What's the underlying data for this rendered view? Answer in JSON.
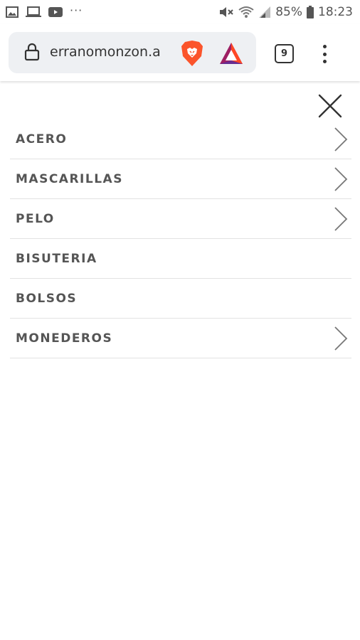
{
  "status_bar": {
    "battery": "85%",
    "time": "18:23",
    "notification_icons": [
      "image-icon",
      "laptop-icon",
      "youtube-icon"
    ],
    "system_icons": [
      "mute-icon",
      "wifi-icon",
      "signal-icon",
      "battery-icon"
    ],
    "more": "···"
  },
  "browser": {
    "url": "erranomonzon.a",
    "tab_count": "9"
  },
  "menu": {
    "items": [
      {
        "label": "ACERO",
        "has_submenu": true
      },
      {
        "label": "MASCARILLAS",
        "has_submenu": true
      },
      {
        "label": "PELO",
        "has_submenu": true
      },
      {
        "label": "BISUTERIA",
        "has_submenu": false
      },
      {
        "label": "BOLSOS",
        "has_submenu": false
      },
      {
        "label": "MONEDEROS",
        "has_submenu": true
      }
    ]
  },
  "colors": {
    "brave_orange": "#fb542b",
    "bat_red": "#ff4724",
    "bat_purple": "#9e1f63",
    "divider": "#e2e2e2"
  }
}
